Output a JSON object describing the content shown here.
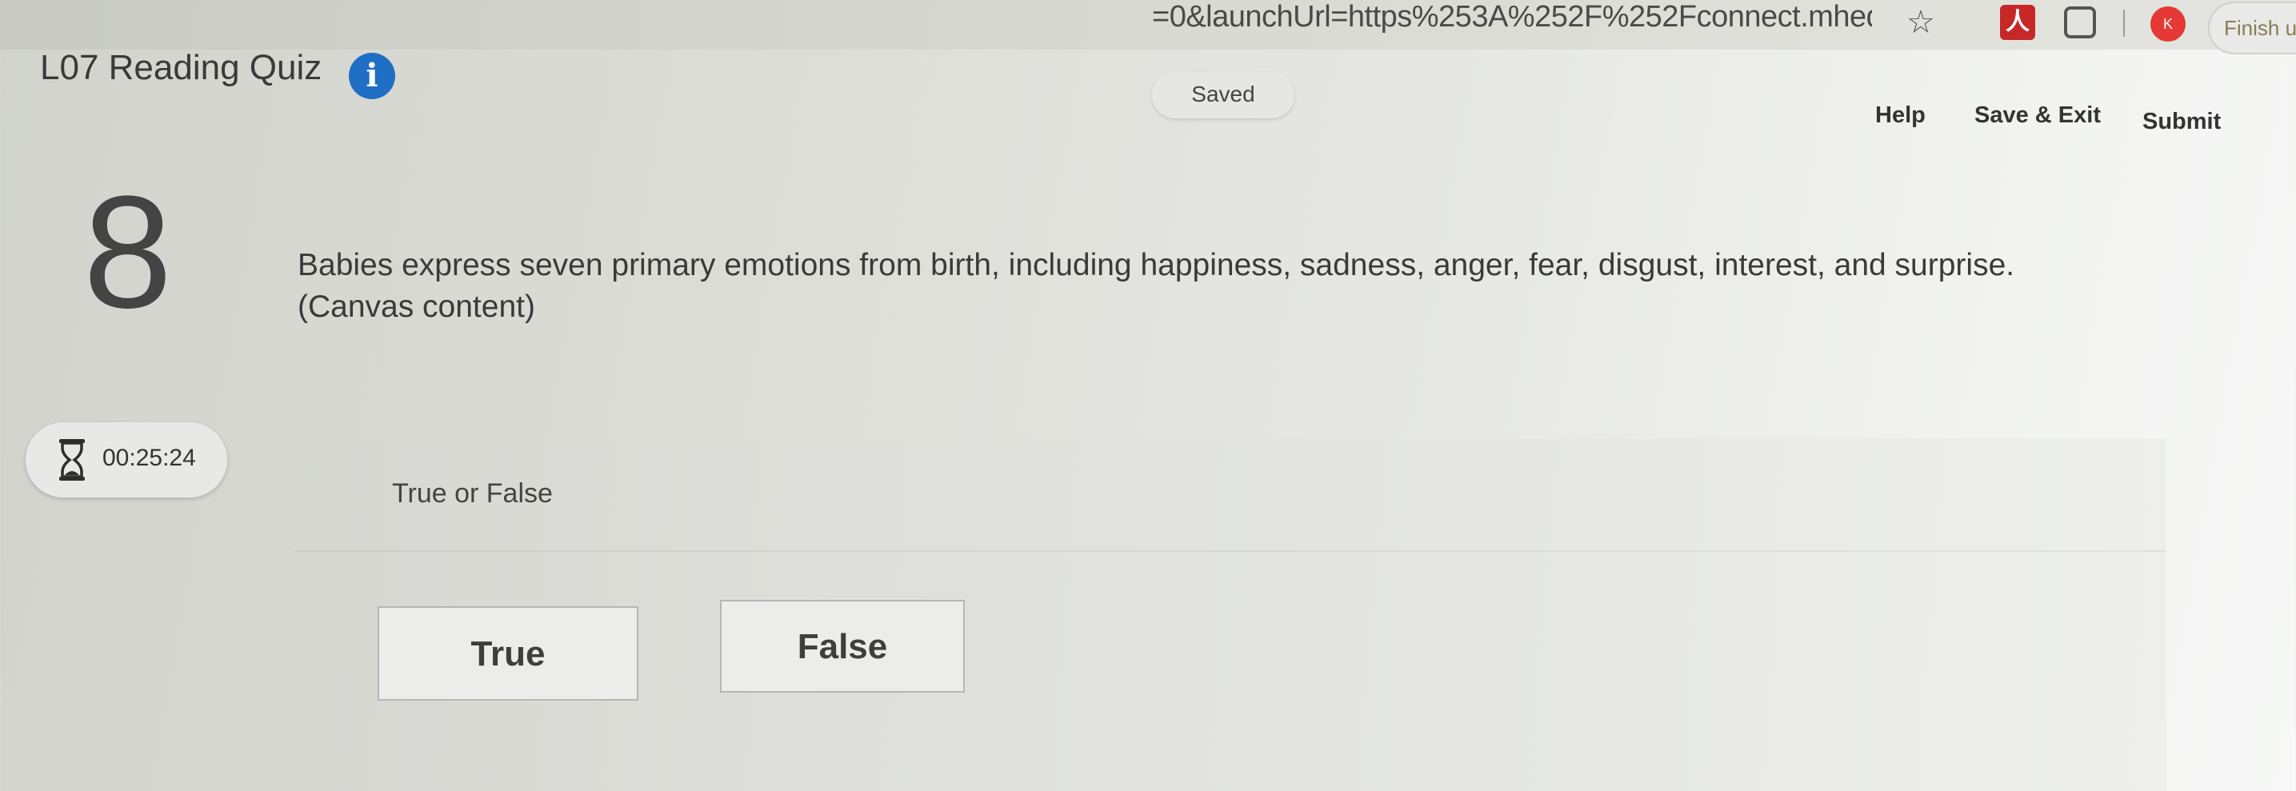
{
  "browser": {
    "url_fragment": "=0&launchUrl=https%253A%252F%252Fconnect.mheduc...",
    "finish_label": "Finish u"
  },
  "header": {
    "quiz_title": "L07 Reading Quiz",
    "saved_label": "Saved",
    "help_label": "Help",
    "save_exit_label": "Save & Exit",
    "submit_label": "Submit"
  },
  "question": {
    "number": "8",
    "text": "Babies express seven primary emotions from birth, including happiness, sadness, anger, fear, disgust, interest, and surprise.",
    "source_note": "(Canvas content)",
    "type_label": "True or False"
  },
  "timer": {
    "value": "00:25:24"
  },
  "choices": {
    "true_label": "True",
    "false_label": "False"
  },
  "colors": {
    "info_icon": "#1f6fc5",
    "pdf_icon": "#c62828",
    "profile_icon": "#e53935"
  },
  "icons": {
    "info": "info-icon",
    "timer": "hourglass-icon",
    "bookmark": "star-icon",
    "pdf": "pdf-icon",
    "extensions": "puzzle-icon",
    "profile": "profile-icon"
  }
}
